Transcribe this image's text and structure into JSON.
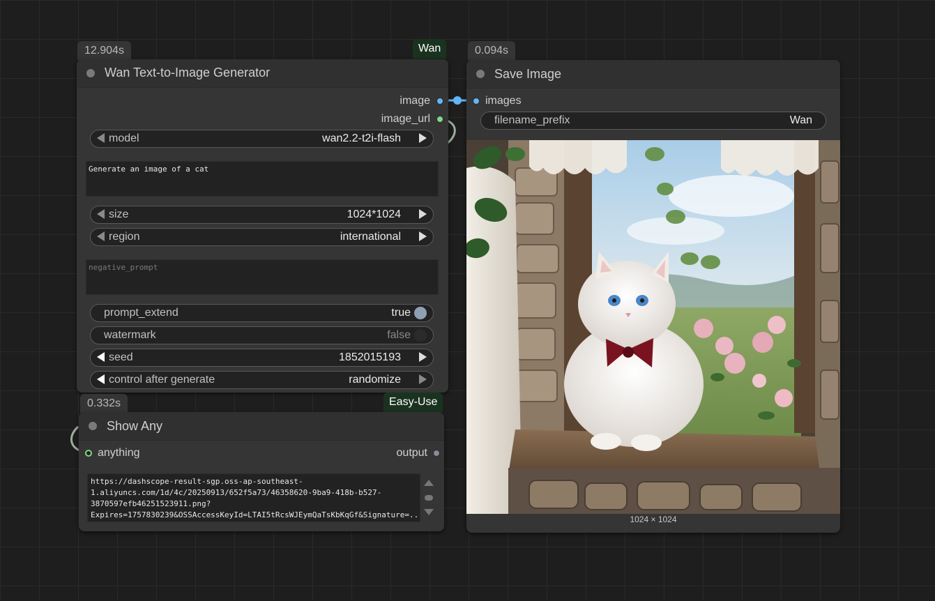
{
  "generator_node": {
    "time": "12.904s",
    "tag": "Wan",
    "title": "Wan Text-to-Image Generator",
    "outputs": [
      "image",
      "image_url"
    ],
    "model": {
      "label": "model",
      "value": "wan2.2-t2i-flash"
    },
    "prompt": "Generate an image of a cat",
    "size": {
      "label": "size",
      "value": "1024*1024"
    },
    "region": {
      "label": "region",
      "value": "international"
    },
    "negative_prompt_placeholder": "negative_prompt",
    "prompt_extend": {
      "label": "prompt_extend",
      "value": "true"
    },
    "watermark": {
      "label": "watermark",
      "value": "false"
    },
    "seed": {
      "label": "seed",
      "value": "1852015193"
    },
    "control_after_generate": {
      "label": "control after generate",
      "value": "randomize"
    }
  },
  "save_node": {
    "time": "0.094s",
    "title": "Save Image",
    "input": "images",
    "filename_prefix": {
      "label": "filename_prefix",
      "value": "Wan"
    },
    "image_caption": "1024 × 1024"
  },
  "show_node": {
    "time": "0.332s",
    "tag": "Easy-Use",
    "title": "Show Any",
    "input": "anything",
    "output": "output",
    "text": "https://dashscope-result-sgp.oss-ap-southeast-1.aliyuncs.com/1d/4c/20250913/652f5a73/46358620-9ba9-418b-b527-3870597efb46251523911.png?Expires=1757830239&OSSAccessKeyId=LTAI5tRcsWJEymQaTsKbKqGf&Signature=..."
  },
  "colors": {
    "canvas": "#1e1e1e",
    "node": "#353535",
    "image_link": "#64b5f6",
    "string_link": "#7fd98a",
    "tag_bg": "#1a3320"
  }
}
